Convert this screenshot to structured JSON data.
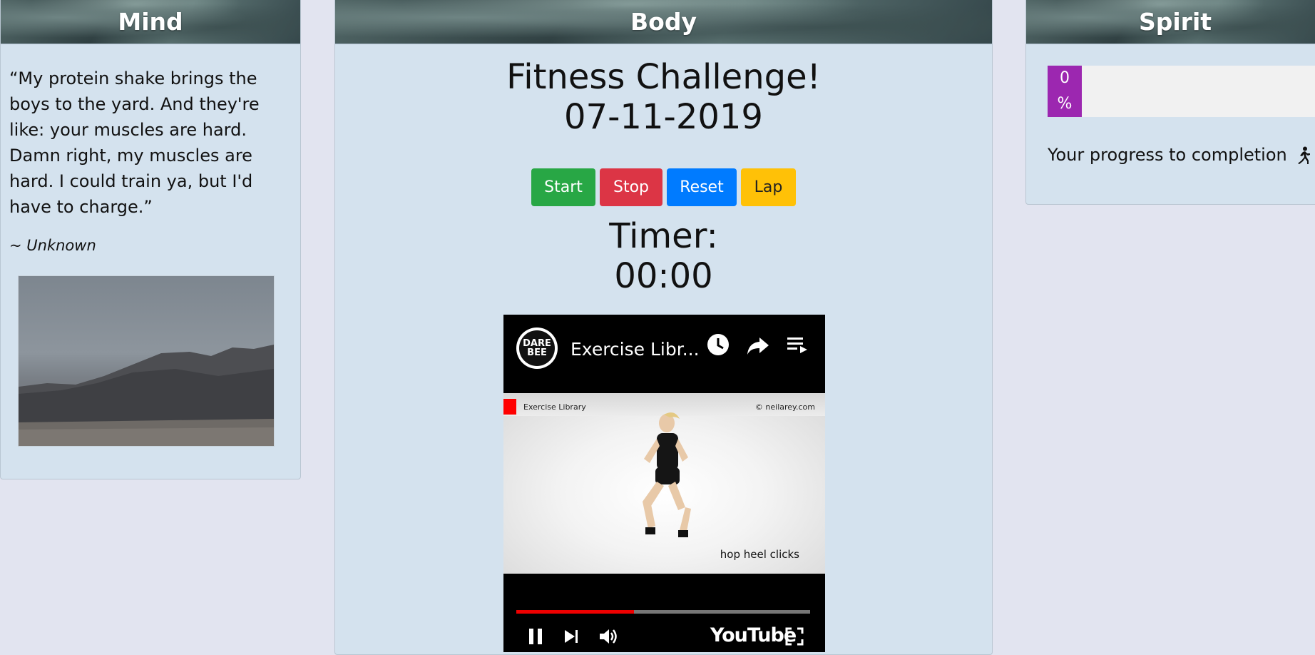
{
  "columns": {
    "mind": {
      "header": "Mind"
    },
    "body": {
      "header": "Body"
    },
    "spirit": {
      "header": "Spirit"
    }
  },
  "mind": {
    "quote": "“My protein shake brings the boys to the yard. And they're like: your muscles are hard. Damn right, my muscles are hard. I could train ya, but I'd have to charge.”",
    "attribution": "~ Unknown",
    "image_alt": "mountain landscape"
  },
  "body": {
    "title": "Fitness Challenge!",
    "date": "07-11-2019",
    "buttons": {
      "start": "Start",
      "stop": "Stop",
      "reset": "Reset",
      "lap": "Lap"
    },
    "timer_label": "Timer:",
    "timer_value": "00:00",
    "video": {
      "channel_logo": "DARE BEE",
      "title": "Exercise Libr...",
      "frame_label_left": "Exercise Library",
      "frame_label_right": "© neilarey.com",
      "frame_caption": "hop heel clicks",
      "brand": "YouTube",
      "progress_fraction": 0.4,
      "icons": [
        "clock-icon",
        "share-icon",
        "playlist-icon",
        "pause-icon",
        "next-icon",
        "volume-icon",
        "fullscreen-icon"
      ]
    }
  },
  "spirit": {
    "progress_value": "0",
    "progress_unit": "%",
    "progress_text": "Your progress to completion",
    "icon": "running-icon",
    "accent": "#9c27b0"
  },
  "colors": {
    "page_bg": "#e2e4f0",
    "card_bg": "#d4e2ee",
    "start": "#28a745",
    "stop": "#dc3545",
    "reset": "#007bff",
    "lap": "#ffc107"
  }
}
